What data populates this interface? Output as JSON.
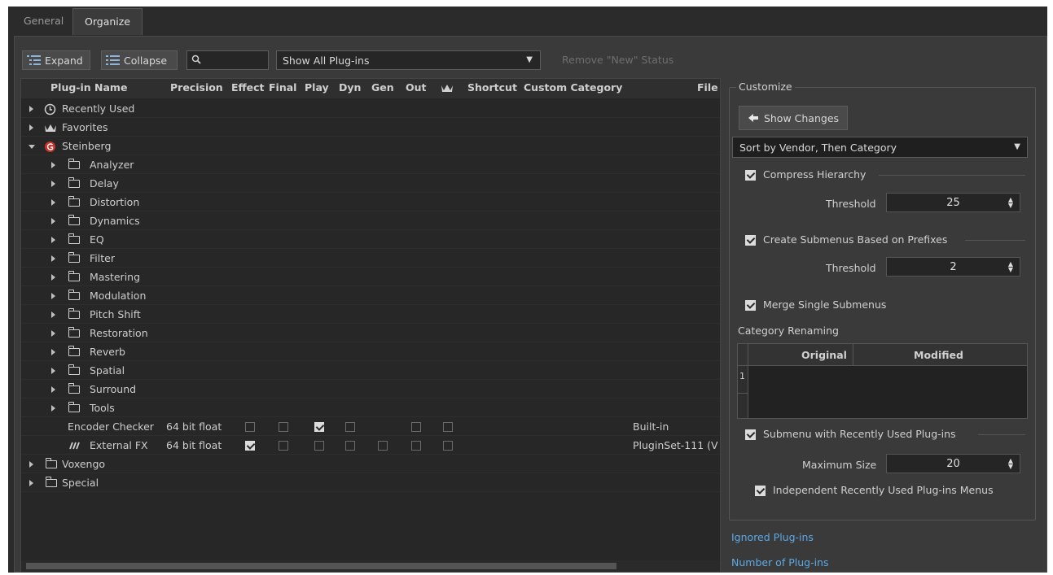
{
  "tabs": [
    {
      "label": "General",
      "active": false
    },
    {
      "label": "Organize",
      "active": true
    }
  ],
  "toolbar": {
    "expand_label": "Expand",
    "collapse_label": "Collapse",
    "search_value": "",
    "filter_value": "Show All Plug-ins",
    "remove_new_label": "Remove \"New\" Status"
  },
  "columns": {
    "name": "Plug-in Name",
    "precision": "Precision",
    "effect": "Effect",
    "final": "Final",
    "play": "Play",
    "dyn": "Dyn",
    "gen": "Gen",
    "out": "Out",
    "crown": "crown-icon",
    "shortcut": "Shortcut",
    "custom_category": "Custom Category",
    "file": "File"
  },
  "tree": {
    "recently_used": "Recently Used",
    "favorites": "Favorites",
    "steinberg": "Steinberg",
    "categories": [
      "Analyzer",
      "Delay",
      "Distortion",
      "Dynamics",
      "EQ",
      "Filter",
      "Mastering",
      "Modulation",
      "Pitch Shift",
      "Restoration",
      "Reverb",
      "Spatial",
      "Surround",
      "Tools"
    ],
    "plugins": [
      {
        "name": "Encoder Checker",
        "precision": "64 bit float",
        "file": "Built-in",
        "checks": [
          false,
          false,
          true,
          false,
          null,
          false,
          false
        ]
      },
      {
        "name": "External FX",
        "precision": "64 bit float",
        "file": "PluginSet-111 (V",
        "checks": [
          true,
          false,
          false,
          false,
          false,
          false,
          false
        ]
      }
    ],
    "voxengo": "Voxengo",
    "special": "Special"
  },
  "customize": {
    "title": "Customize",
    "show_changes": "Show Changes",
    "sort_value": "Sort by Vendor, Then Category",
    "compress_hierarchy": "Compress Hierarchy",
    "threshold_label": "Threshold",
    "threshold1": "25",
    "create_submenus": "Create Submenus Based on Prefixes",
    "threshold2": "2",
    "merge_single": "Merge Single Submenus",
    "category_renaming": "Category Renaming",
    "col_original": "Original",
    "col_modified": "Modified",
    "row_number": "1",
    "submenu_recent": "Submenu with Recently Used Plug-ins",
    "max_size_label": "Maximum Size",
    "max_size": "20",
    "independent_recent": "Independent Recently Used Plug-ins Menus"
  },
  "links": {
    "ignored": "Ignored Plug-ins",
    "number": "Number of Plug-ins"
  }
}
